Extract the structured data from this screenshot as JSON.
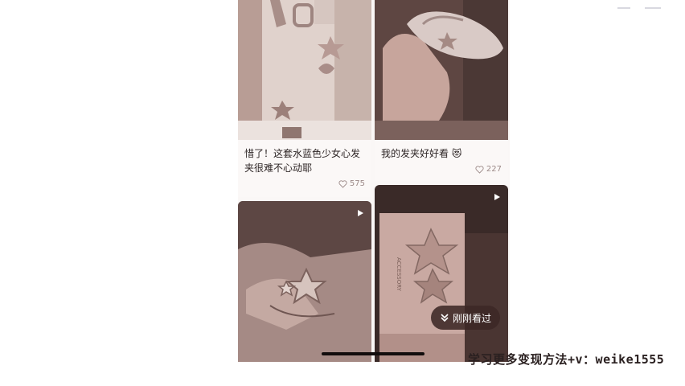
{
  "feed": {
    "cards": [
      {
        "title": "惜了！这套水蓝色少女心发夹很难不心动耶",
        "likes": "575",
        "video": false
      },
      {
        "title": "我的发夹好好看 😻",
        "likes": "227",
        "video": false
      },
      {
        "title": "",
        "likes": "",
        "video": true
      },
      {
        "title": "",
        "likes": "",
        "video": true
      }
    ],
    "recent_button_label": "刚刚看过"
  },
  "watermark": "学习更多变现方法+v：weike1555",
  "icons": {
    "like": "heart-icon",
    "video": "play-icon",
    "recent": "double-chevron-down-icon"
  },
  "colors": {
    "page_bg": "#ffffff",
    "feed_bg": "#faf7f6",
    "text": "#2c2424",
    "muted": "#9c8a88"
  }
}
